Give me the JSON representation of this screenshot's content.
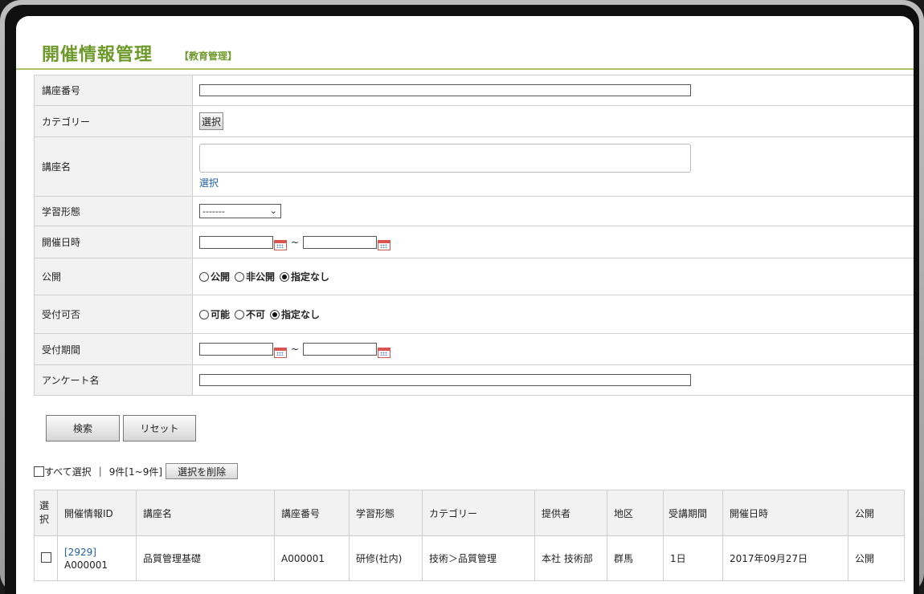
{
  "header": {
    "title": "開催情報管理",
    "subtitle": "【教育管理】"
  },
  "form": {
    "course_number": {
      "label": "講座番号",
      "value": ""
    },
    "category": {
      "label": "カテゴリー",
      "button": "選択"
    },
    "course_name": {
      "label": "講座名",
      "value": "",
      "link": "選択"
    },
    "learning_format": {
      "label": "学習形態",
      "selected": "-------"
    },
    "event_date": {
      "label": "開催日時",
      "from": "",
      "to": "",
      "separator": "~"
    },
    "publish": {
      "label": "公開",
      "options": [
        {
          "label": "公開",
          "checked": false
        },
        {
          "label": "非公開",
          "checked": false
        },
        {
          "label": "指定なし",
          "checked": true
        }
      ]
    },
    "acceptance": {
      "label": "受付可否",
      "options": [
        {
          "label": "可能",
          "checked": false
        },
        {
          "label": "不可",
          "checked": false
        },
        {
          "label": "指定なし",
          "checked": true
        }
      ]
    },
    "acceptance_period": {
      "label": "受付期間",
      "from": "",
      "to": "",
      "separator": "~"
    },
    "survey_name": {
      "label": "アンケート名",
      "value": ""
    }
  },
  "actions": {
    "search": "検索",
    "reset": "リセット"
  },
  "list_controls": {
    "select_all": "すべて選択",
    "divider": "|",
    "count": "9件[1~9件]",
    "delete_selected": "選択を削除"
  },
  "table": {
    "columns": [
      "選択",
      "開催情報ID",
      "講座名",
      "講座番号",
      "学習形態",
      "カテゴリー",
      "提供者",
      "地区",
      "受講期間",
      "開催日時",
      "公開"
    ],
    "rows": [
      {
        "id_link": "[2929]",
        "id_code": "A000001",
        "course_name": "品質管理基礎",
        "course_number": "A000001",
        "format": "研修(社内)",
        "category": "技術＞品質管理",
        "provider": "本社 技術部",
        "region": "群馬",
        "period": "1日",
        "date": "2017年09月27日",
        "publish": "公開"
      }
    ]
  }
}
